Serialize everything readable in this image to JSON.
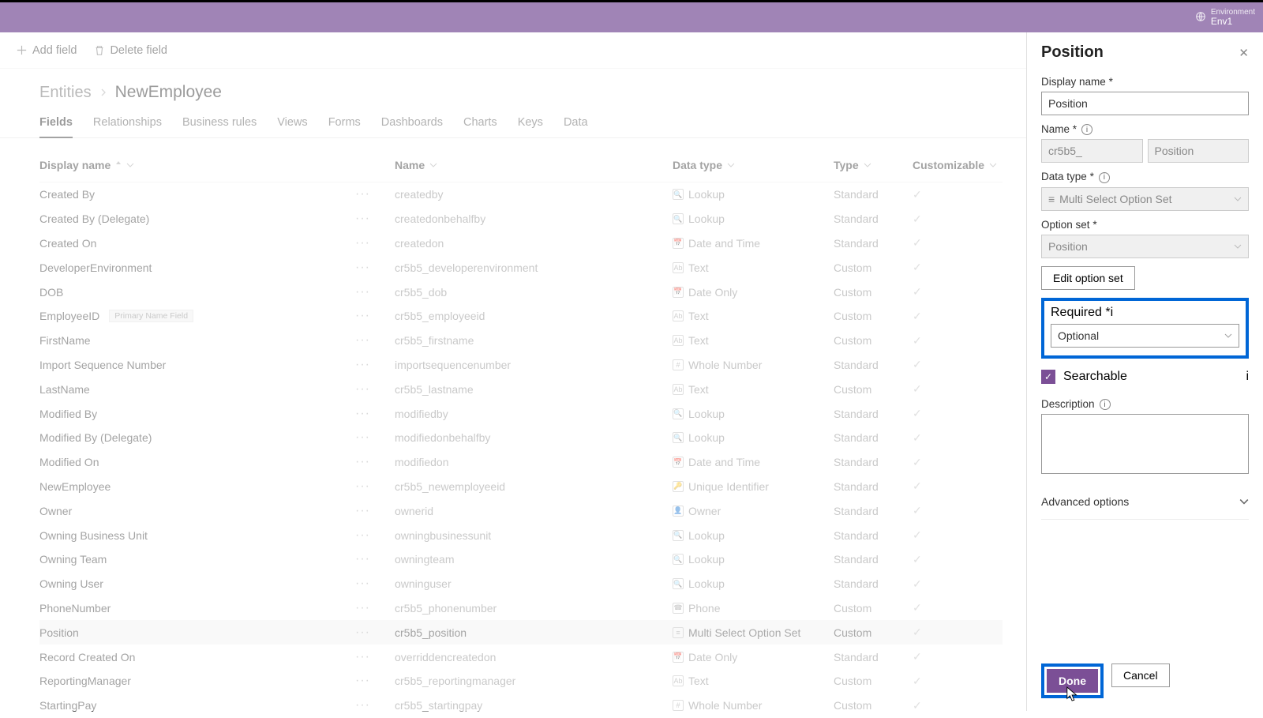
{
  "header": {
    "env_label": "Environment",
    "env_value": "Env1"
  },
  "commands": {
    "add_field": "Add field",
    "delete_field": "Delete field"
  },
  "breadcrumb": {
    "root": "Entities",
    "current": "NewEmployee"
  },
  "tabs": [
    "Fields",
    "Relationships",
    "Business rules",
    "Views",
    "Forms",
    "Dashboards",
    "Charts",
    "Keys",
    "Data"
  ],
  "tab_active": "Fields",
  "table": {
    "headers": {
      "display_name": "Display name",
      "name": "Name",
      "data_type": "Data type",
      "type": "Type",
      "customizable": "Customizable"
    },
    "primary_badge": "Primary Name Field",
    "rows": [
      {
        "display": "Created By",
        "name": "createdby",
        "dtype": "Lookup",
        "icon": "lookup",
        "type": "Standard",
        "cust": true
      },
      {
        "display": "Created By (Delegate)",
        "name": "createdonbehalfby",
        "dtype": "Lookup",
        "icon": "lookup",
        "type": "Standard",
        "cust": true
      },
      {
        "display": "Created On",
        "name": "createdon",
        "dtype": "Date and Time",
        "icon": "datetime",
        "type": "Standard",
        "cust": true
      },
      {
        "display": "DeveloperEnvironment",
        "name": "cr5b5_developerenvironment",
        "dtype": "Text",
        "icon": "text",
        "type": "Custom",
        "cust": true
      },
      {
        "display": "DOB",
        "name": "cr5b5_dob",
        "dtype": "Date Only",
        "icon": "date",
        "type": "Custom",
        "cust": true
      },
      {
        "display": "EmployeeID",
        "name": "cr5b5_employeeid",
        "dtype": "Text",
        "icon": "text",
        "type": "Custom",
        "cust": true,
        "primary": true
      },
      {
        "display": "FirstName",
        "name": "cr5b5_firstname",
        "dtype": "Text",
        "icon": "text",
        "type": "Custom",
        "cust": true
      },
      {
        "display": "Import Sequence Number",
        "name": "importsequencenumber",
        "dtype": "Whole Number",
        "icon": "number",
        "type": "Standard",
        "cust": true
      },
      {
        "display": "LastName",
        "name": "cr5b5_lastname",
        "dtype": "Text",
        "icon": "text",
        "type": "Custom",
        "cust": true
      },
      {
        "display": "Modified By",
        "name": "modifiedby",
        "dtype": "Lookup",
        "icon": "lookup",
        "type": "Standard",
        "cust": true
      },
      {
        "display": "Modified By (Delegate)",
        "name": "modifiedonbehalfby",
        "dtype": "Lookup",
        "icon": "lookup",
        "type": "Standard",
        "cust": true
      },
      {
        "display": "Modified On",
        "name": "modifiedon",
        "dtype": "Date and Time",
        "icon": "datetime",
        "type": "Standard",
        "cust": true
      },
      {
        "display": "NewEmployee",
        "name": "cr5b5_newemployeeid",
        "dtype": "Unique Identifier",
        "icon": "id",
        "type": "Standard",
        "cust": true
      },
      {
        "display": "Owner",
        "name": "ownerid",
        "dtype": "Owner",
        "icon": "owner",
        "type": "Standard",
        "cust": true
      },
      {
        "display": "Owning Business Unit",
        "name": "owningbusinessunit",
        "dtype": "Lookup",
        "icon": "lookup",
        "type": "Standard",
        "cust": true
      },
      {
        "display": "Owning Team",
        "name": "owningteam",
        "dtype": "Lookup",
        "icon": "lookup",
        "type": "Standard",
        "cust": true
      },
      {
        "display": "Owning User",
        "name": "owninguser",
        "dtype": "Lookup",
        "icon": "lookup",
        "type": "Standard",
        "cust": true
      },
      {
        "display": "PhoneNumber",
        "name": "cr5b5_phonenumber",
        "dtype": "Phone",
        "icon": "phone",
        "type": "Custom",
        "cust": true
      },
      {
        "display": "Position",
        "name": "cr5b5_position",
        "dtype": "Multi Select Option Set",
        "icon": "multiselect",
        "type": "Custom",
        "cust": true,
        "selected": true
      },
      {
        "display": "Record Created On",
        "name": "overriddencreatedon",
        "dtype": "Date Only",
        "icon": "date",
        "type": "Standard",
        "cust": true
      },
      {
        "display": "ReportingManager",
        "name": "cr5b5_reportingmanager",
        "dtype": "Text",
        "icon": "text",
        "type": "Custom",
        "cust": true
      },
      {
        "display": "StartingPay",
        "name": "cr5b5_startingpay",
        "dtype": "Whole Number",
        "icon": "number",
        "type": "Custom",
        "cust": true
      }
    ]
  },
  "panel": {
    "title": "Position",
    "labels": {
      "display_name": "Display name",
      "name": "Name",
      "data_type": "Data type",
      "option_set": "Option set",
      "edit_option_set": "Edit option set",
      "required": "Required",
      "searchable": "Searchable",
      "description": "Description",
      "advanced": "Advanced options"
    },
    "values": {
      "display_name": "Position",
      "name_prefix": "cr5b5_",
      "name": "Position",
      "data_type": "Multi Select Option Set",
      "option_set": "Position",
      "required": "Optional",
      "searchable": true,
      "description": ""
    },
    "buttons": {
      "done": "Done",
      "cancel": "Cancel"
    }
  }
}
